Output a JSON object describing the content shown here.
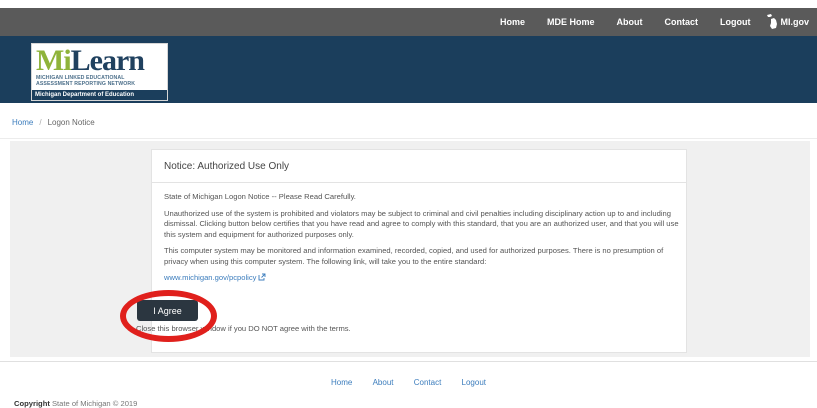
{
  "topnav": {
    "items": [
      "Home",
      "MDE Home",
      "About",
      "Contact",
      "Logout"
    ],
    "migov": "MI.gov"
  },
  "logo": {
    "word_a": "Mi",
    "word_b": "Learn",
    "line1": "MICHIGAN LINKED EDUCATIONAL",
    "line2": "ASSESSMENT REPORTING NETWORK",
    "dept": "Michigan Department of Education"
  },
  "breadcrumb": {
    "home": "Home",
    "separator": "/",
    "current": "Logon Notice"
  },
  "notice": {
    "title": "Notice: Authorized Use Only",
    "p1": "State of Michigan Logon Notice -- Please Read Carefully.",
    "p2": "Unauthorized use of the system is prohibited and violators may be subject to criminal and civil penalties including disciplinary action up to and including dismissal. Clicking button below certifies that you have read and agree to comply with this standard, that you are an authorized user, and that you will use this system and equipment for authorized purposes only.",
    "p3": "This computer system may be monitored and information examined, recorded, copied, and used for authorized purposes. There is no presumption of privacy when using this computer system. The following link, will take you to the entire standard:",
    "link": "www.michigan.gov/pcpolicy",
    "agree_label": "I Agree",
    "close_note": "Close this browser window if you DO NOT agree with the terms."
  },
  "footer": {
    "links": [
      "Home",
      "About",
      "Contact",
      "Logout"
    ],
    "copyright_label": "Copyright",
    "copyright_text": "State of Michigan © 2019"
  },
  "colors": {
    "topbar": "#5a5a5a",
    "banner": "#1b3e5c",
    "link": "#3c7dbd",
    "button": "#2b3640",
    "highlight_ring": "#e0201c"
  }
}
